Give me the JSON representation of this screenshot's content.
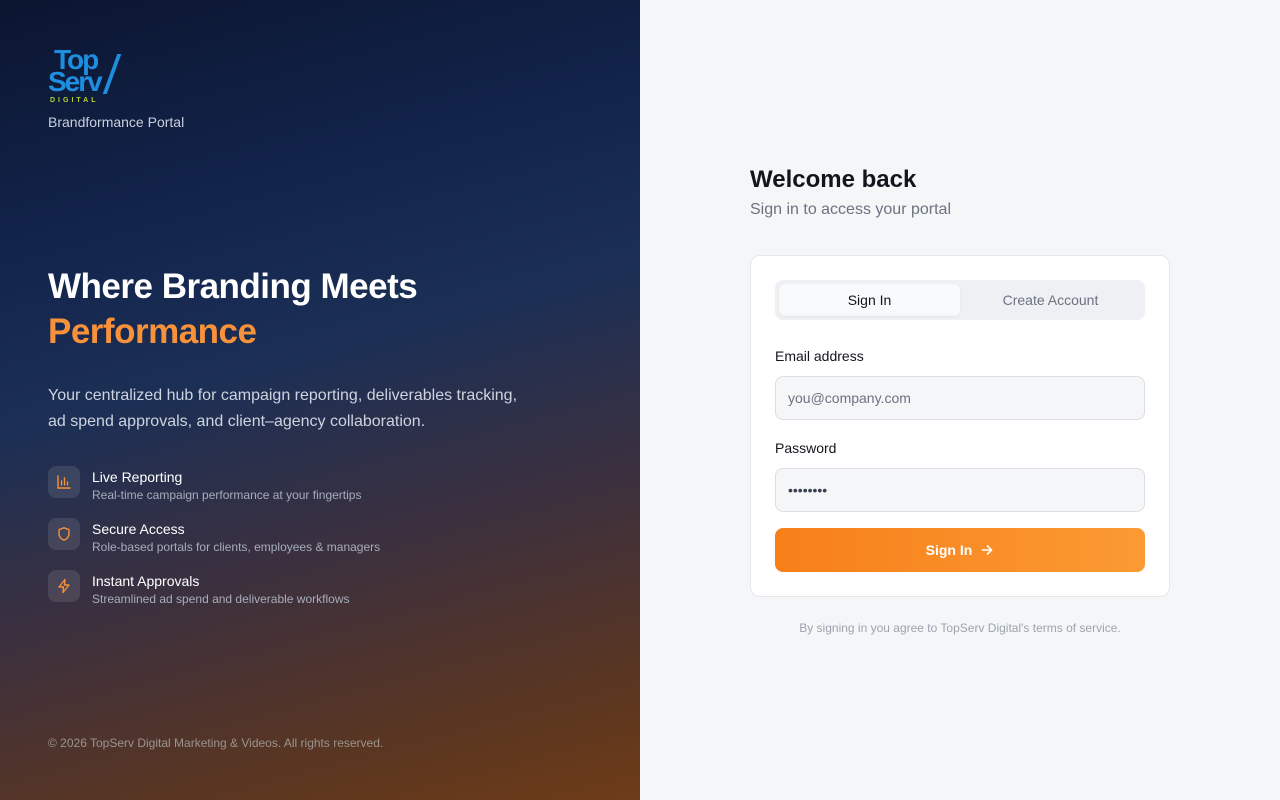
{
  "brand": {
    "logo_line1": "Top",
    "logo_line2": "Serv",
    "logo_sub": "DIGITAL",
    "portal_name": "Brandformance Portal"
  },
  "hero": {
    "headline_line1": "Where Branding Meets",
    "headline_line2": "Performance",
    "description": "Your centralized hub for campaign reporting, deliverables tracking, ad spend approvals, and client–agency collaboration."
  },
  "features": [
    {
      "icon": "bar-chart-icon",
      "title": "Live Reporting",
      "subtitle": "Real-time campaign performance at your fingertips"
    },
    {
      "icon": "shield-icon",
      "title": "Secure Access",
      "subtitle": "Role-based portals for clients, employees & managers"
    },
    {
      "icon": "lightning-icon",
      "title": "Instant Approvals",
      "subtitle": "Streamlined ad spend and deliverable workflows"
    }
  ],
  "copyright": "© 2026 TopServ Digital Marketing & Videos. All rights reserved.",
  "auth": {
    "title": "Welcome back",
    "subtitle": "Sign in to access your portal",
    "tabs": {
      "signin": "Sign In",
      "create": "Create Account"
    },
    "email_label": "Email address",
    "email_placeholder": "you@company.com",
    "password_label": "Password",
    "password_value": "••••••••",
    "submit_label": "Sign In",
    "terms": "By signing in you agree to TopServ Digital's terms of service."
  },
  "colors": {
    "accent": "#f7913a",
    "brand_blue": "#1e8ee0",
    "brand_green": "#b8d430"
  }
}
